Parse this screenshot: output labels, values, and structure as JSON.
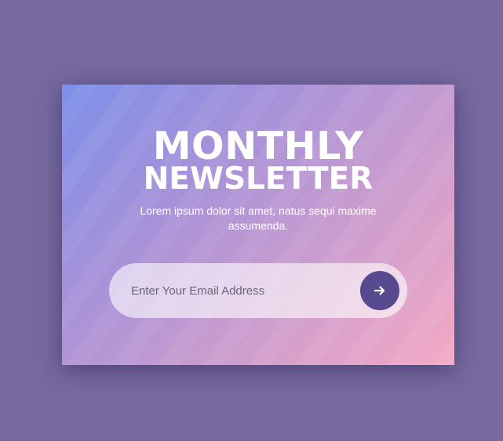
{
  "newsletter": {
    "title_line1": "MONTHLY",
    "title_line2": "NEWSLETTER",
    "description": "Lorem ipsum dolor sit amet, natus sequi maxime assumenda.",
    "email_placeholder": "Enter Your Email Address",
    "email_value": "",
    "submit_icon": "arrow-right-icon"
  },
  "colors": {
    "page_background": "#776aa0",
    "gradient_start": "#7c8fe9",
    "gradient_end": "#f4a9c4",
    "button": "#574a8e",
    "text": "#ffffff"
  }
}
